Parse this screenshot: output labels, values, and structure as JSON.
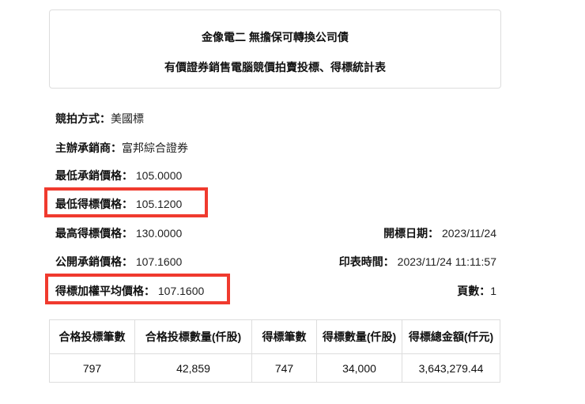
{
  "header": {
    "title": "金像電二 無擔保可轉換公司債",
    "subtitle": "有價證券銷售電腦競價拍賣投標、得標統計表"
  },
  "info": [
    {
      "label": "競拍方式：",
      "value": "美國標"
    },
    {
      "label": "主辦承銷商：",
      "value": "富邦綜合證券"
    },
    {
      "label": "最低承銷價格：",
      "value": " 105.0000"
    },
    {
      "label": "最低得標價格：",
      "value": " 105.1200",
      "highlighted": true
    },
    {
      "label": "最高得標價格：",
      "value": " 130.0000"
    },
    {
      "label": "公開承銷價格：",
      "value": " 107.1600"
    },
    {
      "label": "得標加權平均價格：",
      "value": " 107.1600",
      "highlighted": true
    }
  ],
  "right_info": [
    {
      "label": "開標日期：",
      "value": " 2023/11/24"
    },
    {
      "label": "印表時間：",
      "value": " 2023/11/24 11:11:57"
    },
    {
      "label": "頁數：",
      "value": "1"
    }
  ],
  "table": {
    "headers": [
      "合格投標筆數",
      "合格投標數量(仟股)",
      "得標筆數",
      "得標數量(仟股)",
      "得標總金額(仟元)"
    ],
    "rows": [
      [
        "797",
        "42,859",
        "747",
        "34,000",
        "3,643,279.44"
      ]
    ]
  },
  "colors": {
    "highlight": "#f03a2e"
  }
}
